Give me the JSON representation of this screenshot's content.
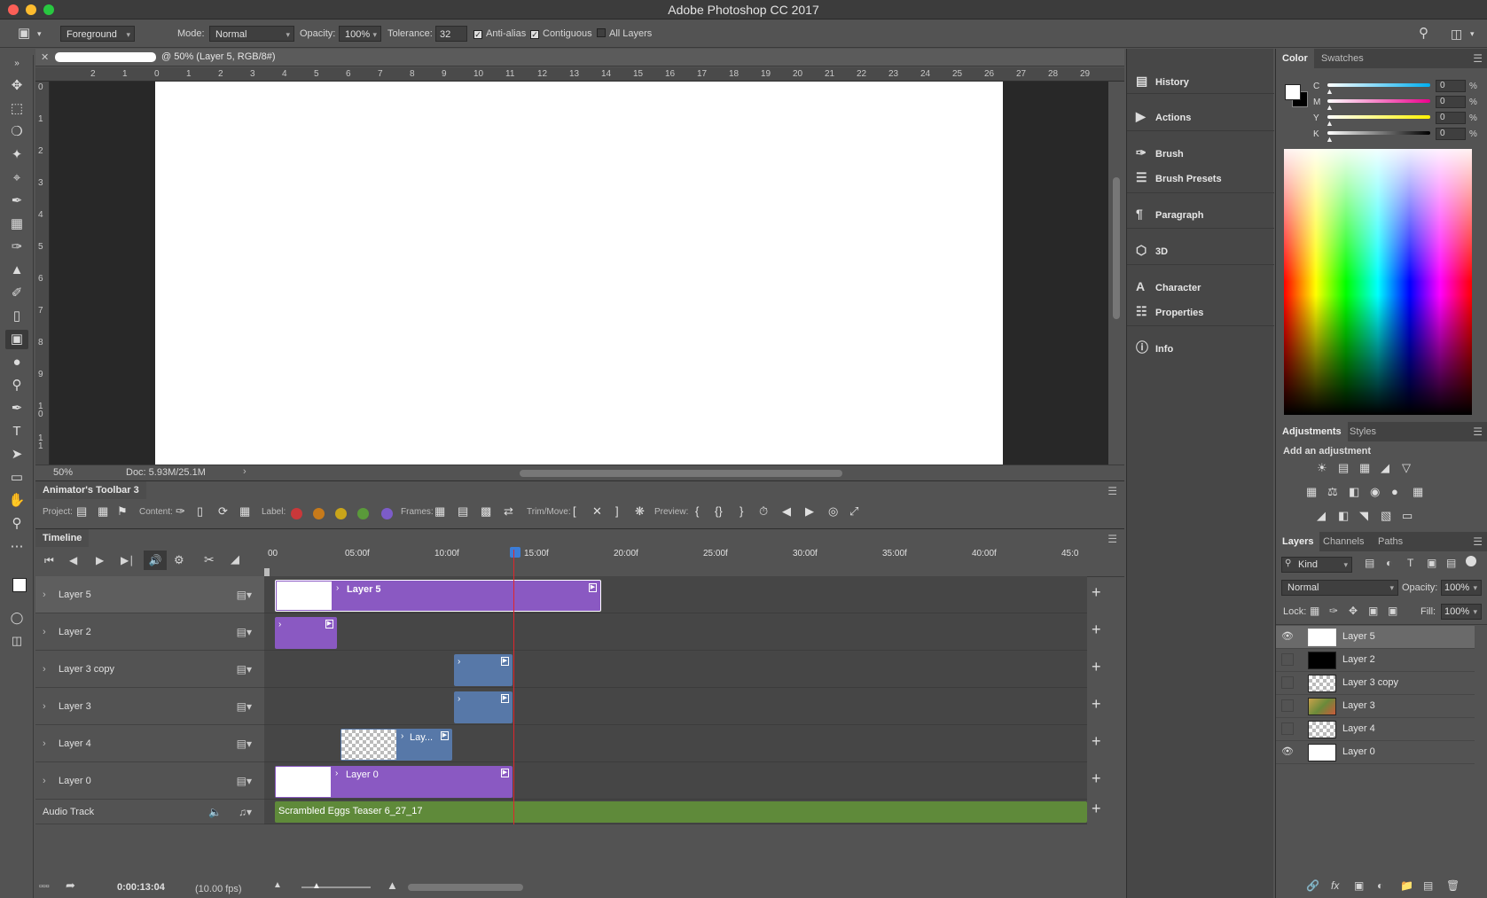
{
  "window": {
    "title": "Adobe Photoshop CC 2017"
  },
  "options": {
    "fill_source": "Foreground",
    "mode_label": "Mode:",
    "mode_value": "Normal",
    "opacity_label": "Opacity:",
    "opacity_value": "100%",
    "tolerance_label": "Tolerance:",
    "tolerance_value": "32",
    "antialias_label": "Anti-alias",
    "contiguous_label": "Contiguous",
    "all_layers_label": "All Layers"
  },
  "document": {
    "tab_title": "@ 50% (Layer 5, RGB/8#)",
    "zoom": "50%",
    "doc_size": "Doc: 5.93M/25.1M",
    "ruler_top": [
      "2",
      "1",
      "0",
      "1",
      "2",
      "3",
      "4",
      "5",
      "6",
      "7",
      "8",
      "9",
      "10",
      "11",
      "12",
      "13",
      "14",
      "15",
      "16",
      "17",
      "18",
      "19",
      "20",
      "21",
      "22",
      "23",
      "24",
      "25",
      "26",
      "27",
      "28",
      "29"
    ],
    "ruler_left": [
      "0",
      "1",
      "2",
      "3",
      "4",
      "5",
      "6",
      "7",
      "8",
      "9",
      "1 0",
      "1 1"
    ]
  },
  "animator": {
    "title": "Animator's Toolbar 3",
    "project_label": "Project:",
    "content_label": "Content:",
    "label_label": "Label:",
    "frames_label": "Frames:",
    "trim_label": "Trim/Move:",
    "preview_label": "Preview:",
    "label_colors": [
      "#c9383a",
      "#c77a1a",
      "#c9a51a",
      "#5a9a3a",
      "#7c5cc9"
    ]
  },
  "timeline": {
    "title": "Timeline",
    "ruler": [
      "00",
      "05:00f",
      "10:00f",
      "15:00f",
      "20:00f",
      "25:00f",
      "30:00f",
      "35:00f",
      "40:00f",
      "45:0"
    ],
    "tracks": [
      {
        "name": "Layer 5"
      },
      {
        "name": "Layer 2"
      },
      {
        "name": "Layer 3 copy"
      },
      {
        "name": "Layer 3"
      },
      {
        "name": "Layer 4"
      },
      {
        "name": "Layer 0"
      }
    ],
    "clips": {
      "layer5": "Layer 5",
      "layer4": "Lay...",
      "layer0": "Layer 0"
    },
    "audio": {
      "label": "Audio Track",
      "clip": "Scrambled Eggs Teaser 6_27_17"
    },
    "current_time": "0:00:13:04",
    "fps": "(10.00 fps)",
    "clip_colors": {
      "purple": "#8a59c2",
      "blue": "#5778a8",
      "green": "#5f8a3a"
    }
  },
  "panels": {
    "history": "History",
    "actions": "Actions",
    "brush": "Brush",
    "brush_presets": "Brush Presets",
    "paragraph": "Paragraph",
    "3d": "3D",
    "character": "Character",
    "properties": "Properties",
    "info": "Info"
  },
  "color": {
    "tab_color": "Color",
    "tab_swatches": "Swatches",
    "channels": [
      {
        "label": "C",
        "value": "0"
      },
      {
        "label": "M",
        "value": "0"
      },
      {
        "label": "Y",
        "value": "0"
      },
      {
        "label": "K",
        "value": "0"
      }
    ],
    "pct": "%"
  },
  "adjustments": {
    "tab_adjustments": "Adjustments",
    "tab_styles": "Styles",
    "hint": "Add an adjustment"
  },
  "layers": {
    "tab_layers": "Layers",
    "tab_channels": "Channels",
    "tab_paths": "Paths",
    "filter": "Kind",
    "blend": "Normal",
    "opacity_label": "Opacity:",
    "opacity_value": "100%",
    "lock_label": "Lock:",
    "fill_label": "Fill:",
    "fill_value": "100%",
    "items": [
      {
        "name": "Layer 5",
        "visible": true
      },
      {
        "name": "Layer 2",
        "visible": false
      },
      {
        "name": "Layer 3 copy",
        "visible": false
      },
      {
        "name": "Layer 3",
        "visible": false
      },
      {
        "name": "Layer 4",
        "visible": false
      },
      {
        "name": "Layer 0",
        "visible": true
      }
    ]
  }
}
